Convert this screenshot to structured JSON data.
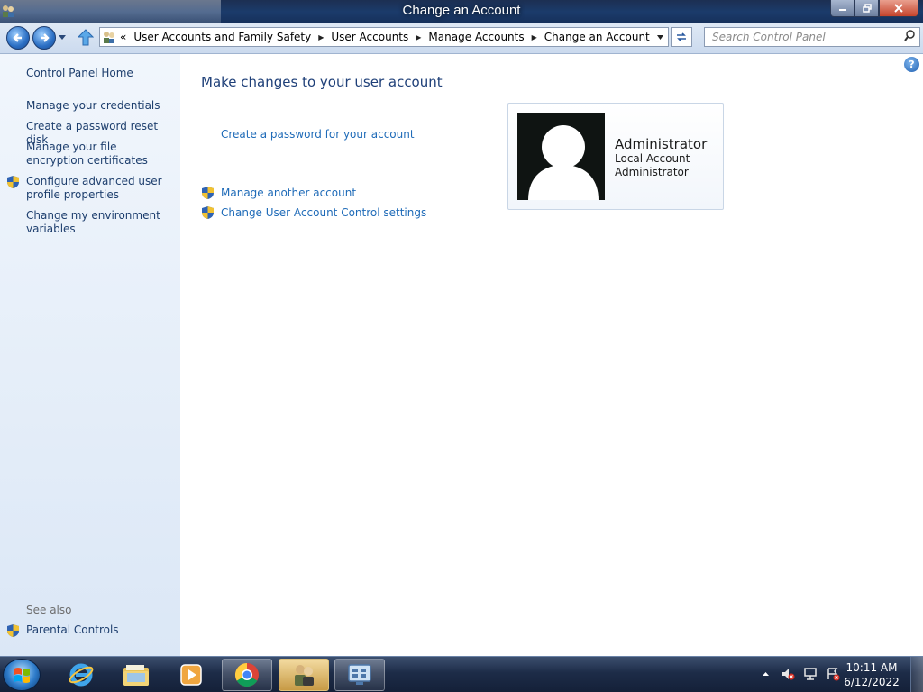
{
  "window": {
    "title": "Change an Account"
  },
  "address_bar": {
    "prefix": "«",
    "crumbs": [
      "User Accounts and Family Safety",
      "User Accounts",
      "Manage Accounts",
      "Change an Account"
    ],
    "search_placeholder": "Search Control Panel"
  },
  "sidebar": {
    "home": "Control Panel Home",
    "links": [
      "Manage your credentials",
      "Create a password reset disk",
      "Manage your file encryption certificates",
      "Configure advanced user profile properties",
      "Change my environment variables"
    ],
    "see_also_label": "See also",
    "see_also_links": [
      "Parental Controls"
    ]
  },
  "main": {
    "title": "Make changes to your user account",
    "links": [
      "Create a password for your account",
      "Manage another account",
      "Change User Account Control settings"
    ],
    "account": {
      "name": "Administrator",
      "type": "Local Account",
      "role": "Administrator"
    }
  },
  "taskbar": {
    "time": "10:11 AM",
    "date": "6/12/2022",
    "items": [
      "internet-explorer-icon",
      "file-explorer-icon",
      "media-player-icon",
      "chrome-icon",
      "user-accounts-icon",
      "control-panel-icon"
    ]
  },
  "colors": {
    "link": "#1f6bb8",
    "sidebar_link": "#1e3f6e",
    "title_blue": "#1e3f78"
  }
}
